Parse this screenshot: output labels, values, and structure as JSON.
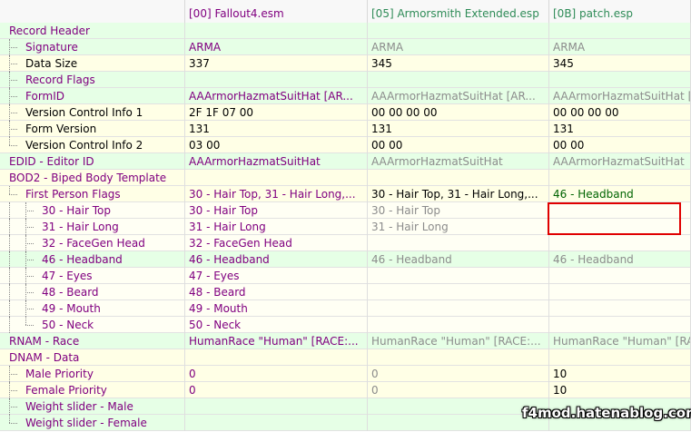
{
  "columns": [
    "[00] Fallout4.esm",
    "[05] Armorsmith Extended.esp",
    "[0B] patch.esp"
  ],
  "rows": [
    {
      "name": "Record Header",
      "v1": "",
      "v2": "",
      "v3": ""
    },
    {
      "name": "Signature",
      "v1": "ARMA",
      "v2": "ARMA",
      "v3": "ARMA"
    },
    {
      "name": "Data Size",
      "v1": "337",
      "v2": "345",
      "v3": "345"
    },
    {
      "name": "Record Flags",
      "v1": "",
      "v2": "",
      "v3": ""
    },
    {
      "name": "FormID",
      "v1": "AAArmorHazmatSuitHat [AR...",
      "v2": "AAArmorHazmatSuitHat [AR...",
      "v3": "AAArmorHazmatSuitHat [AR..."
    },
    {
      "name": "Version Control Info 1",
      "v1": "2F 1F 07 00",
      "v2": "00 00 00 00",
      "v3": "00 00 00 00"
    },
    {
      "name": "Form Version",
      "v1": "131",
      "v2": "131",
      "v3": "131"
    },
    {
      "name": "Version Control Info 2",
      "v1": "03 00",
      "v2": "00 00",
      "v3": "00 00"
    },
    {
      "name": "EDID - Editor ID",
      "v1": "AAArmorHazmatSuitHat",
      "v2": "AAArmorHazmatSuitHat",
      "v3": "AAArmorHazmatSuitHat"
    },
    {
      "name": "BOD2 - Biped Body Template",
      "v1": "",
      "v2": "",
      "v3": ""
    },
    {
      "name": "First Person Flags",
      "v1": "30 - Hair Top, 31 - Hair Long,...",
      "v2": "30 - Hair Top, 31 - Hair Long,...",
      "v3": "46 - Headband"
    },
    {
      "name": "30 - Hair Top",
      "v1": "30 - Hair Top",
      "v2": "30 - Hair Top",
      "v3": ""
    },
    {
      "name": "31 - Hair Long",
      "v1": "31 - Hair Long",
      "v2": "31 - Hair Long",
      "v3": ""
    },
    {
      "name": "32 - FaceGen Head",
      "v1": "32 - FaceGen Head",
      "v2": "",
      "v3": ""
    },
    {
      "name": "46 - Headband",
      "v1": "46 - Headband",
      "v2": "46 - Headband",
      "v3": "46 - Headband"
    },
    {
      "name": "47 - Eyes",
      "v1": "47 - Eyes",
      "v2": "",
      "v3": ""
    },
    {
      "name": "48 - Beard",
      "v1": "48 - Beard",
      "v2": "",
      "v3": ""
    },
    {
      "name": "49 - Mouth",
      "v1": "49 - Mouth",
      "v2": "",
      "v3": ""
    },
    {
      "name": "50 - Neck",
      "v1": "50 - Neck",
      "v2": "",
      "v3": ""
    },
    {
      "name": "RNAM - Race",
      "v1": "HumanRace \"Human\" [RACE:...",
      "v2": "HumanRace \"Human\" [RACE:...",
      "v3": "HumanRace \"Human\" [RA"
    },
    {
      "name": "DNAM - Data",
      "v1": "",
      "v2": "",
      "v3": ""
    },
    {
      "name": "Male Priority",
      "v1": "0",
      "v2": "0",
      "v3": "10"
    },
    {
      "name": "Female Priority",
      "v1": "0",
      "v2": "0",
      "v3": "10"
    },
    {
      "name": "Weight slider - Male",
      "v1": "",
      "v2": "",
      "v3": ""
    },
    {
      "name": "Weight slider - Female",
      "v1": "",
      "v2": "",
      "v3": ""
    }
  ],
  "watermark": "f4mod.hatenablog.com"
}
